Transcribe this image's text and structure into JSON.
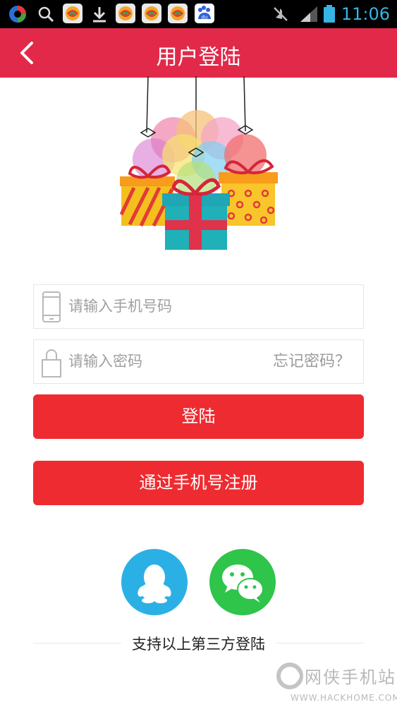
{
  "status_bar": {
    "time": "11:06",
    "time_color": "#35b5e5",
    "icons": [
      "app-icon",
      "search-icon",
      "app-icon",
      "download-icon",
      "app-icon",
      "app-icon",
      "app-icon",
      "baidu-icon",
      "mute-icon",
      "signal-icon",
      "battery-icon"
    ],
    "baidu_label": "du"
  },
  "header": {
    "title": "用户登陆",
    "background": "#e2294a"
  },
  "form": {
    "phone_placeholder": "请输入手机号码",
    "password_placeholder": "请输入密码",
    "forgot_password": "忘记密码？"
  },
  "buttons": {
    "login": "登陆",
    "register": "通过手机号注册",
    "color": "#ee2b30"
  },
  "social": {
    "caption": "支持以上第三方登陆",
    "qq_color": "#2bb0e5",
    "wechat_color": "#2fc44a"
  },
  "watermark": {
    "name": "网侠手机站",
    "url": "WWW.HACKHOME.COM"
  }
}
